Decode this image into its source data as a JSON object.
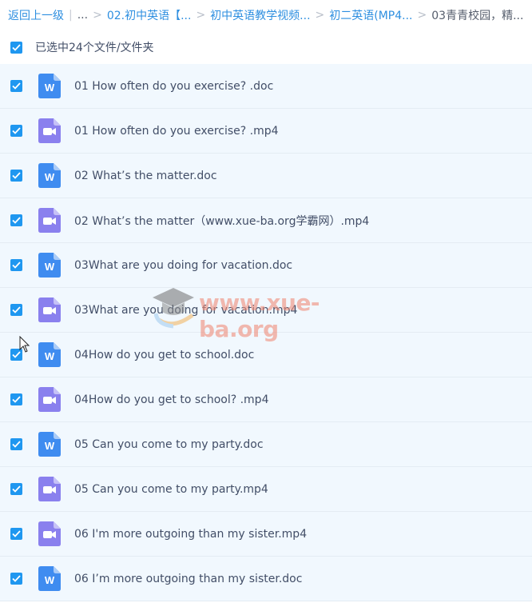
{
  "breadcrumb": {
    "back": "返回上一级",
    "ellipsis": "...",
    "items": [
      "02.初中英语【...",
      "初中英语教学视频...",
      "初二英语(MP4..."
    ],
    "current": "03青青校园，精..."
  },
  "selection": {
    "text": "已选中24个文件/文件夹"
  },
  "files": [
    {
      "name": "01 How often do you exercise?  .doc",
      "icon": "word-icon"
    },
    {
      "name": "01 How often do you exercise?  .mp4",
      "icon": "video-icon"
    },
    {
      "name": "02 What’s the matter.doc",
      "icon": "word-icon"
    },
    {
      "name": "02 What’s the matter（www.xue-ba.org学霸网）.mp4",
      "icon": "video-icon"
    },
    {
      "name": "03What are you doing for vacation.doc",
      "icon": "word-icon"
    },
    {
      "name": "03What are you doing for vacation.mp4",
      "icon": "video-icon"
    },
    {
      "name": "04How do you get to school.doc",
      "icon": "word-icon"
    },
    {
      "name": "04How do you get to school?  .mp4",
      "icon": "video-icon"
    },
    {
      "name": "05 Can you come to my party.doc",
      "icon": "word-icon"
    },
    {
      "name": "05 Can you come to my party.mp4",
      "icon": "video-icon"
    },
    {
      "name": "06 I'm more outgoing than my sister.mp4",
      "icon": "video-icon"
    },
    {
      "name": "06 I’m more outgoing than my sister.doc",
      "icon": "word-icon"
    }
  ],
  "watermark": {
    "text": "www.xue-ba.org"
  },
  "colors": {
    "accent": "#1f97f0",
    "link": "#2e8fe0",
    "row_bg": "#f1f8fe",
    "word_icon": "#3f8cf0",
    "video_icon": "#8a80ee"
  }
}
